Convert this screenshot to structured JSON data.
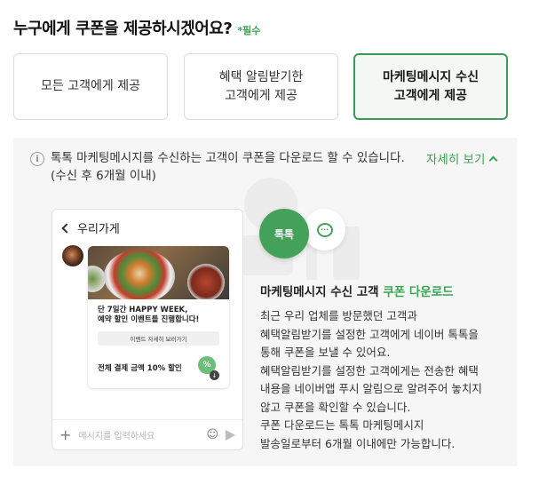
{
  "heading": {
    "question": "누구에게 쿠폰을 제공하시겠어요?",
    "required": "*필수"
  },
  "options": [
    {
      "line1": "모든 고객에게 제공",
      "line2": ""
    },
    {
      "line1": "혜택 알림받기한",
      "line2": "고객에게 제공"
    },
    {
      "line1": "마케팅메시지 수신",
      "line2": "고객에게 제공"
    }
  ],
  "selected_option": 2,
  "info": {
    "icon": "info-icon",
    "text": "톡톡 마케팅메시지를 수신하는 고객이 쿠폰을 다운로드 할 수 있습니다. (수신 후 6개월 이내)",
    "more_label": "자세히 보기"
  },
  "phone": {
    "store_name": "우리가게",
    "promo_line1": "단 7일간 HAPPY WEEK,",
    "promo_line2": "예약 할인 이벤트를 진행합니다!",
    "event_button": "이벤트 자세히 보러가기",
    "discount": "전체 결제 금액 10% 할인",
    "coupon_mark": "%",
    "download_mark": "↓",
    "input_placeholder": "메시지를 입력하세요"
  },
  "badges": {
    "talktalk": "톡톡",
    "chat": "···"
  },
  "detail": {
    "title_main": "마케팅메시지 수신 고객",
    "title_accent": "쿠폰 다운로드",
    "lines": [
      "최근 우리 업체를 방문했던 고객과",
      "혜택알림받기를 설정한 고객에게 네이버 톡톡을",
      "통해 쿠폰을 보낼 수 있어요.",
      "혜택알림받기를 설정한 고객에게는 전송한 혜택",
      "내용을 네이버앱 푸시 알림으로 알려주어 놓치지",
      "않고 쿠폰을 확인할 수 있습니다.",
      "쿠폰 다운로드는 톡톡 마케팅메시지",
      "발송일로부터 6개월 이내에만 가능합니다."
    ]
  },
  "colors": {
    "accent": "#3aa551",
    "selected_border": "#3c9a58",
    "panel_bg": "#f6f6f6"
  }
}
